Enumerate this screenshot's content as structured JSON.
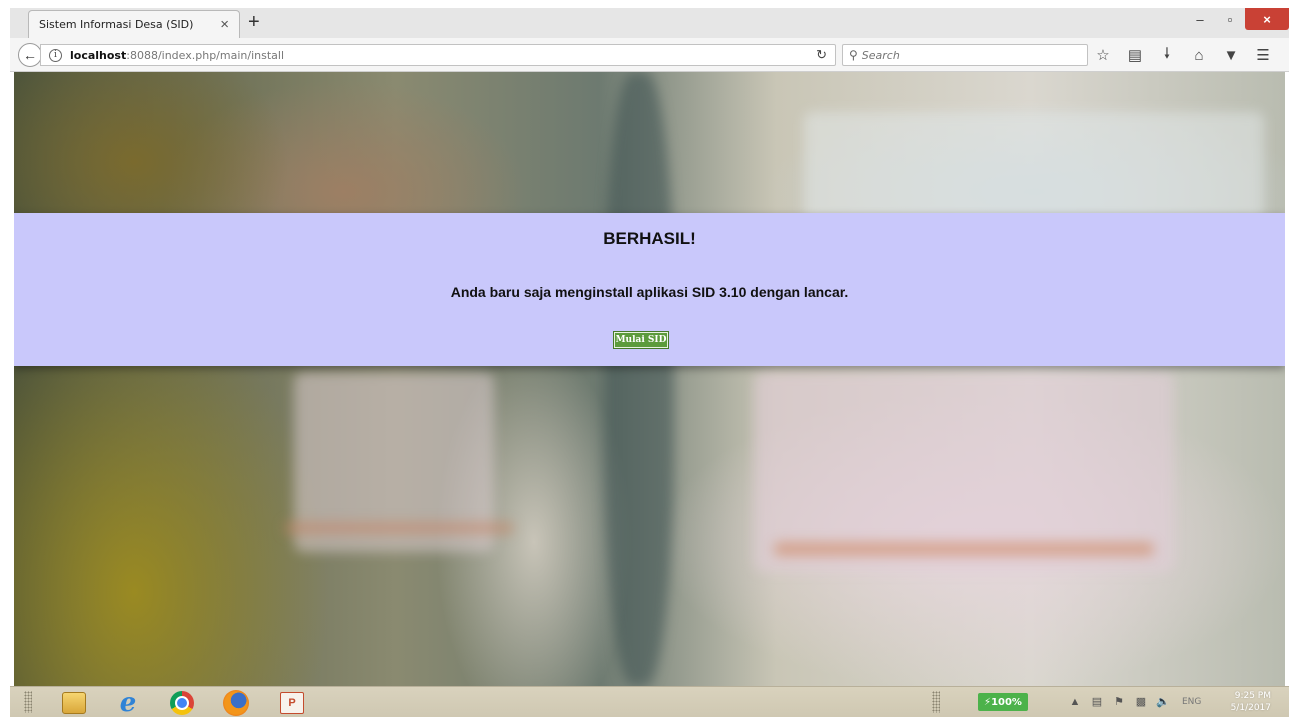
{
  "browser": {
    "tab_title": "Sistem Informasi Desa (SID)",
    "tab_close": "×",
    "new_tab": "+",
    "url_host": "localhost",
    "url_path": ":8088/index.php/main/install",
    "search_placeholder": "Search",
    "window_controls": {
      "minimize": "–",
      "maximize": "▫",
      "close": "×"
    }
  },
  "page": {
    "title": "BERHASIL!",
    "message": "Anda baru saja menginstall aplikasi SID 3.10 dengan lancar.",
    "button_label": "Mulai SID",
    "panel_color": "#c9c8fb",
    "button_color": "#5c9b3c"
  },
  "taskbar": {
    "apps": [
      "file-explorer",
      "internet-explorer",
      "chrome",
      "firefox",
      "powerpoint"
    ],
    "battery": "100%",
    "language": "ENG",
    "time": "9:25 PM",
    "date": "5/1/2017"
  }
}
